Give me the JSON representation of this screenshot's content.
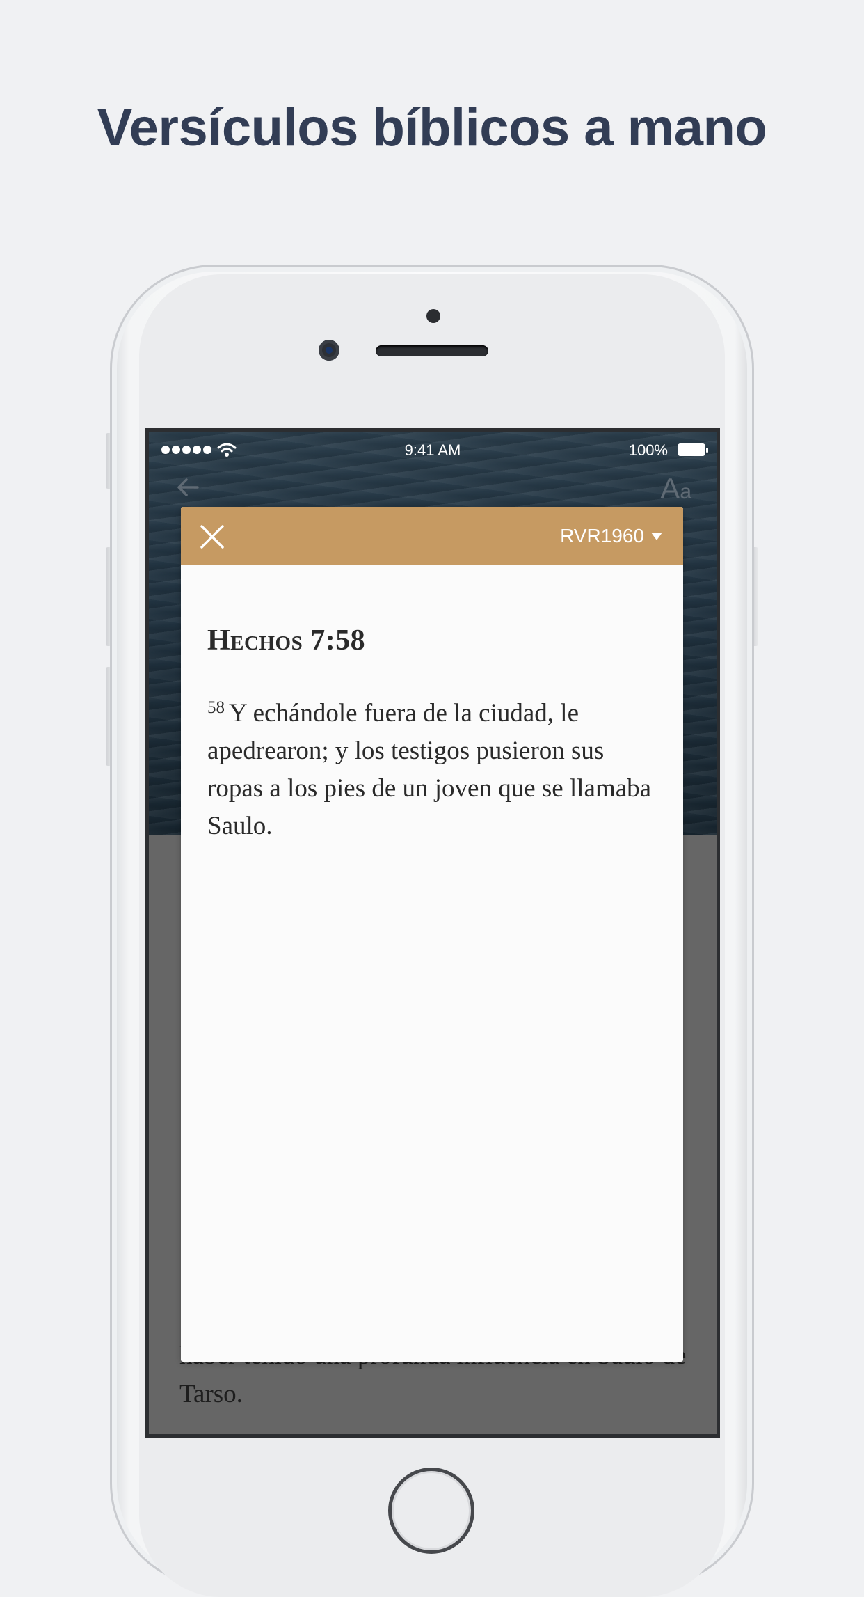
{
  "headline": "Versículos bíblicos a mano",
  "status_bar": {
    "time": "9:41 AM",
    "battery": "100%"
  },
  "nav": {
    "font_button_big": "A",
    "font_button_small": "a"
  },
  "modal": {
    "version": "RVR1960",
    "reference": "Hechos 7:58",
    "verse_number": "58",
    "verse_text": "Y echándole fuera de la ciudad, le apedrearon; y los testigos pusieron sus ropas a los pies de un joven que se llamaba Saulo."
  },
  "background_text": "haber tenido una profunda influencia en Saulo de Tarso.",
  "colors": {
    "header_accent": "#c69a62",
    "headline": "#323d55",
    "page_background": "#f0f1f3"
  },
  "icons": [
    "back-arrow-icon",
    "font-size-icon",
    "close-icon",
    "chevron-down-icon",
    "wifi-icon",
    "battery-icon"
  ]
}
